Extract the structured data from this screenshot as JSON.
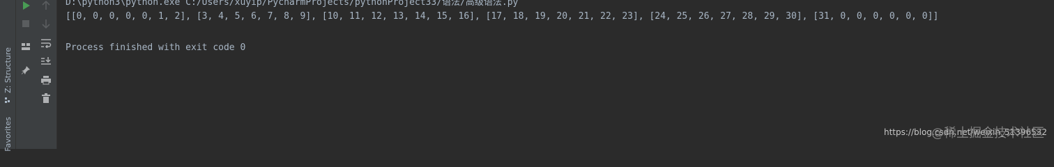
{
  "side_tabs": {
    "structure": "Z: Structure",
    "favorites": "Favorites"
  },
  "toolbar": {
    "icons": [
      "run-icon",
      "arrow-up-icon",
      "stop-icon",
      "arrow-down-icon",
      "layout-icon",
      "soft-wrap-icon",
      "pin-icon",
      "scroll-to-end-icon",
      "print-icon",
      "trash-icon"
    ]
  },
  "console": {
    "command": "D:\\python3\\python.exe C:/Users/xuyip/PycharmProjects/pythonProject33/语法/高级语法.py",
    "output": "[[0, 0, 0, 0, 0, 1, 2], [3, 4, 5, 6, 7, 8, 9], [10, 11, 12, 13, 14, 15, 16], [17, 18, 19, 20, 21, 22, 23], [24, 25, 26, 27, 28, 29, 30], [31, 0, 0, 0, 0, 0, 0]]",
    "exit_message": "Process finished with exit code 0"
  },
  "watermark": {
    "url": "https://blog.csdn.net/weixin_51396532",
    "site_cn": "@稀土掘金技术社区"
  },
  "colors": {
    "background": "#2b2b2b",
    "panel": "#3c3f41",
    "text": "#a9b7c6",
    "run_green": "#499c54"
  }
}
